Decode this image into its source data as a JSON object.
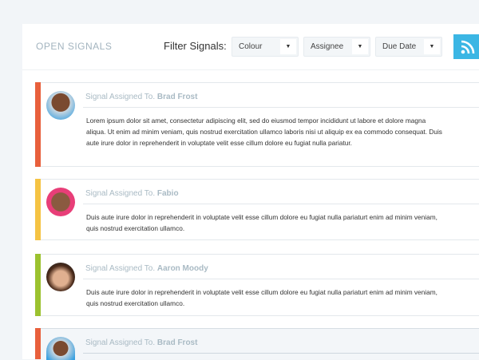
{
  "header": {
    "title": "OPEN SIGNALS",
    "filter_label": "Filter Signals:",
    "filters": [
      {
        "label": "Colour"
      },
      {
        "label": "Assignee"
      },
      {
        "label": "Due Date"
      }
    ],
    "rss_icon": "rss-icon"
  },
  "signals": [
    {
      "prefix": "Signal Assigned To.",
      "assignee": "Brad Frost",
      "color": "#e8603c",
      "body": "Lorem ipsum dolor sit amet, consectetur adipiscing elit, sed do eiusmod tempor incididunt ut labore et dolore magna aliqua. Ut enim ad minim veniam, quis nostrud exercitation ullamco laboris nisi ut aliquip ex ea commodo consequat. Duis aute irure dolor in reprehenderit in voluptate velit esse cillum dolore eu fugiat nulla pariatur."
    },
    {
      "prefix": "Signal Assigned To.",
      "assignee": "Fabio",
      "color": "#f5c343",
      "body": "Duis aute irure dolor in reprehenderit in voluptate velit esse cillum dolore eu fugiat nulla pariaturt enim ad minim veniam, quis nostrud exercitation ullamco."
    },
    {
      "prefix": "Signal Assigned To.",
      "assignee": "Aaron Moody",
      "color": "#9cc22f",
      "body": "Duis aute irure dolor in reprehenderit in voluptate velit esse cillum dolore eu fugiat nulla pariaturt enim ad minim veniam, quis nostrud exercitation ullamco."
    },
    {
      "prefix": "Signal Assigned To.",
      "assignee": "Brad Frost",
      "color": "#e8603c"
    }
  ]
}
